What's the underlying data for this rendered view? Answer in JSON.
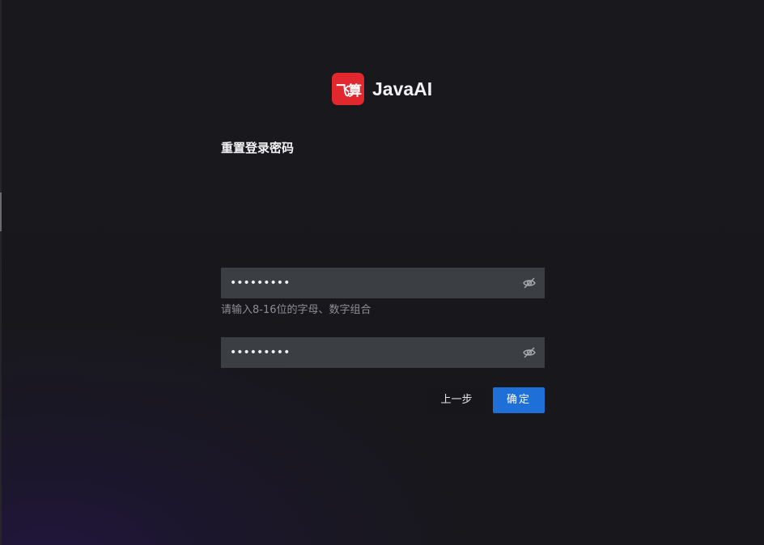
{
  "brand": {
    "logo_text": "飞算",
    "name": "JavaAI",
    "logo_color": "#e0282e"
  },
  "page": {
    "title": "重置登录密码"
  },
  "form": {
    "new_password": {
      "value": "•••••••••",
      "hint": "请输入8-16位的字母、数字组合",
      "toggle_icon": "eye-off-icon"
    },
    "confirm_password": {
      "value": "•••••••••",
      "toggle_icon": "eye-off-icon"
    }
  },
  "actions": {
    "prev_label": "上一步",
    "confirm_label": "确定",
    "accent": "#1f6fd9"
  }
}
